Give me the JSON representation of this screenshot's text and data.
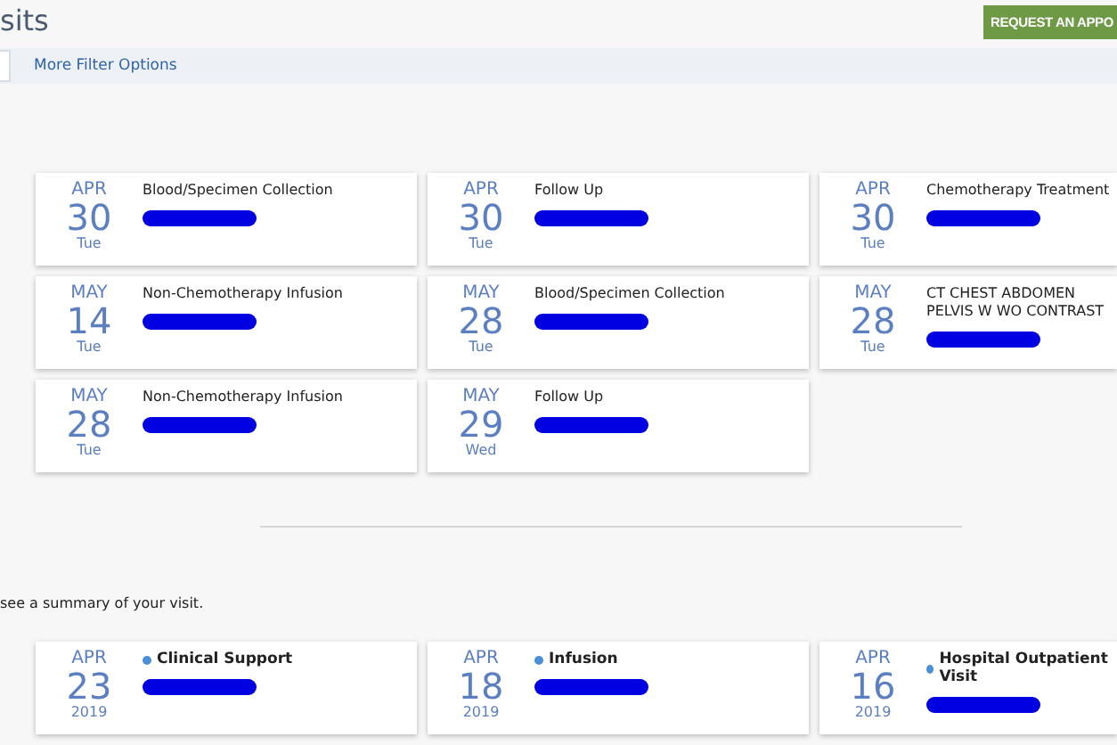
{
  "header": {
    "title": "sits",
    "request_button": "REQUEST AN APPO"
  },
  "filter_bar": {
    "link": "More Filter Options"
  },
  "upcoming": [
    {
      "month": "APR",
      "day": "30",
      "weekday": "Tue",
      "title": "Blood/Specimen Collection"
    },
    {
      "month": "APR",
      "day": "30",
      "weekday": "Tue",
      "title": "Follow Up"
    },
    {
      "month": "APR",
      "day": "30",
      "weekday": "Tue",
      "title": "Chemotherapy Treatment"
    },
    {
      "month": "MAY",
      "day": "14",
      "weekday": "Tue",
      "title": "Non-Chemotherapy Infusion"
    },
    {
      "month": "MAY",
      "day": "28",
      "weekday": "Tue",
      "title": "Blood/Specimen Collection"
    },
    {
      "month": "MAY",
      "day": "28",
      "weekday": "Tue",
      "title": "CT CHEST ABDOMEN PELVIS W WO CONTRAST"
    },
    {
      "month": "MAY",
      "day": "28",
      "weekday": "Tue",
      "title": "Non-Chemotherapy Infusion"
    },
    {
      "month": "MAY",
      "day": "29",
      "weekday": "Wed",
      "title": "Follow Up"
    }
  ],
  "past_note": "see a summary of your visit.",
  "past": [
    {
      "month": "APR",
      "day": "23",
      "year": "2019",
      "title": "Clinical Support",
      "color": "#4a90d9"
    },
    {
      "month": "APR",
      "day": "18",
      "year": "2019",
      "title": "Infusion",
      "color": "#4a90d9"
    },
    {
      "month": "APR",
      "day": "16",
      "year": "2019",
      "title": "Hospital Outpatient Visit",
      "color": "#4a90d9"
    }
  ]
}
